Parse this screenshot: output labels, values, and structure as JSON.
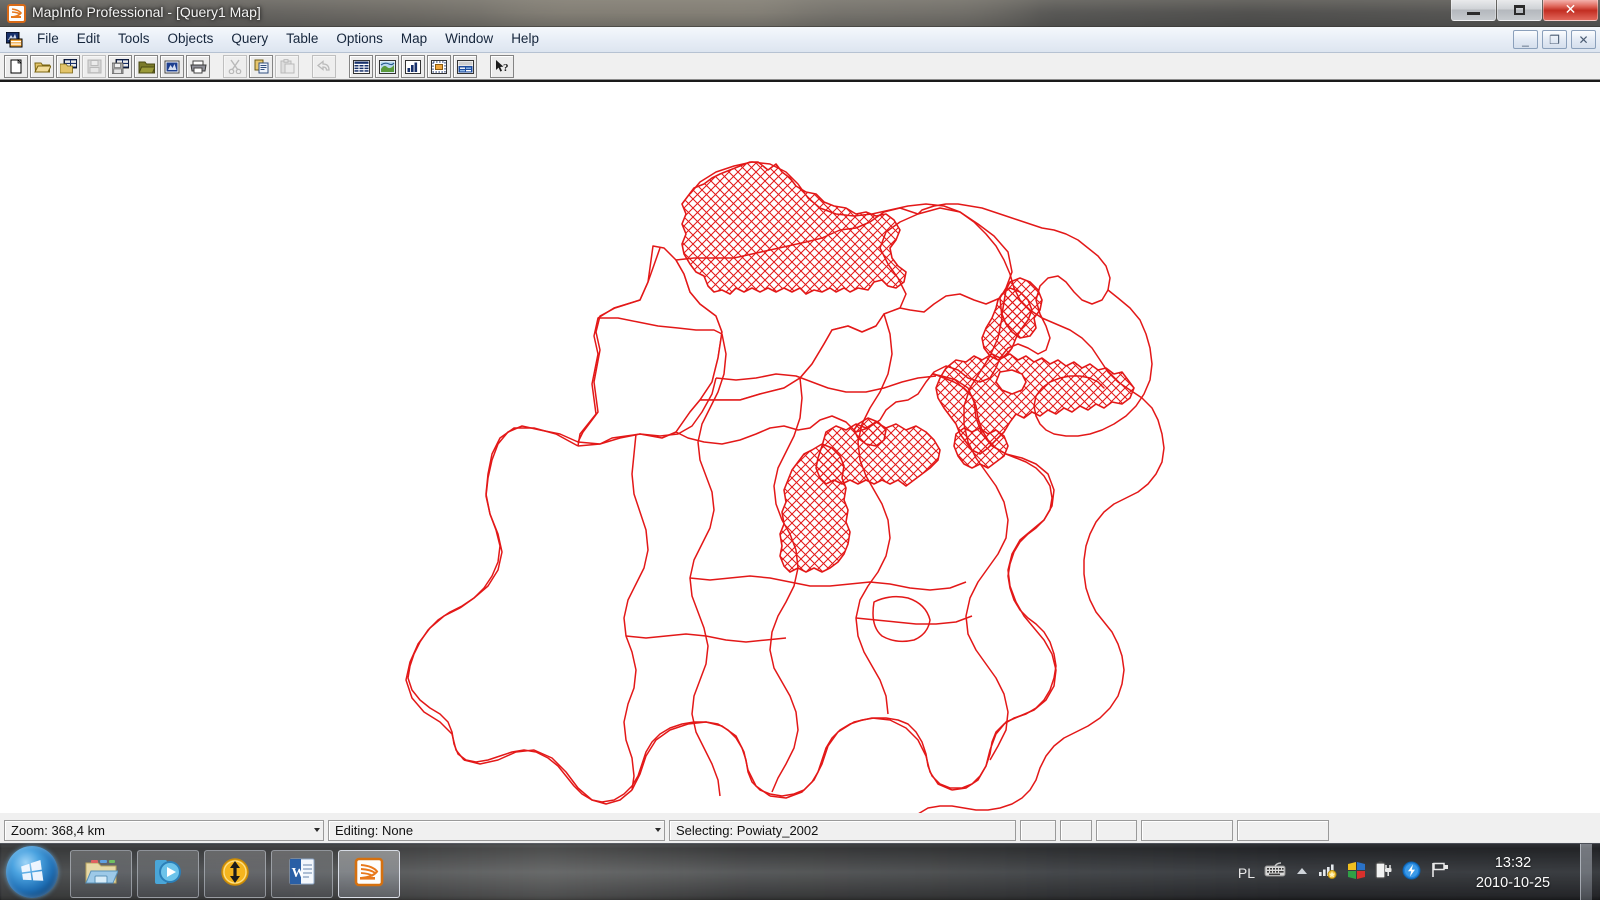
{
  "window": {
    "title": "MapInfo Professional - [Query1 Map]",
    "app_icon": "mapinfo-icon",
    "controls": {
      "minimize": "–",
      "maximize": "□",
      "close": "✕"
    }
  },
  "menubar": {
    "mdi_icon": "mapinfo-document-icon",
    "items": [
      {
        "label": "File"
      },
      {
        "label": "Edit"
      },
      {
        "label": "Tools"
      },
      {
        "label": "Objects"
      },
      {
        "label": "Query"
      },
      {
        "label": "Table"
      },
      {
        "label": "Options"
      },
      {
        "label": "Map"
      },
      {
        "label": "Window"
      },
      {
        "label": "Help"
      }
    ],
    "mdi_controls": {
      "minimize": "_",
      "restore": "❐",
      "close": "✕"
    }
  },
  "toolbar": {
    "buttons": [
      {
        "name": "new-table-icon",
        "title": "New Table",
        "enabled": true
      },
      {
        "name": "open-table-icon",
        "title": "Open Table",
        "enabled": true
      },
      {
        "name": "open-workspace-icon",
        "title": "Open Workspace",
        "enabled": true
      },
      {
        "name": "save-table-icon",
        "title": "Save Table",
        "enabled": false
      },
      {
        "name": "save-workspace-icon",
        "title": "Save Workspace",
        "enabled": true
      },
      {
        "name": "open-folder-icon",
        "title": "Open Directory",
        "enabled": true
      },
      {
        "name": "print-preview-icon",
        "title": "Print Preview",
        "enabled": true
      },
      {
        "name": "print-icon",
        "title": "Print",
        "enabled": true
      },
      {
        "name": "cut-icon",
        "title": "Cut",
        "enabled": false
      },
      {
        "name": "copy-icon",
        "title": "Copy",
        "enabled": true
      },
      {
        "name": "paste-icon",
        "title": "Paste",
        "enabled": false
      },
      {
        "name": "undo-icon",
        "title": "Undo",
        "enabled": false
      },
      {
        "name": "new-browser-icon",
        "title": "New Browser",
        "enabled": true
      },
      {
        "name": "new-mapper-icon",
        "title": "New Mapper",
        "enabled": true
      },
      {
        "name": "new-grapher-icon",
        "title": "New Grapher",
        "enabled": true
      },
      {
        "name": "new-layout-icon",
        "title": "New Layout",
        "enabled": true
      },
      {
        "name": "new-redistrict-icon",
        "title": "New Redistricter",
        "enabled": true
      },
      {
        "name": "help-pointer-icon",
        "title": "Context Help",
        "enabled": true
      }
    ]
  },
  "statusbar": {
    "zoom": "Zoom: 368,4 km",
    "editing": "Editing: None",
    "selecting": "Selecting: Powiaty_2002",
    "extra_panes": [
      "",
      "",
      "",
      "",
      ""
    ]
  },
  "map": {
    "layer_name": "Powiaty_2002",
    "border_color": "#e31818",
    "fill_color": "#ffffff",
    "selection_pattern": "cross-hatch",
    "selection_color": "#e31818",
    "background": "#ffffff",
    "selected_region_count": 4
  },
  "taskbar": {
    "start_button": "start-orb-icon",
    "apps": [
      {
        "name": "explorer-icon",
        "label": "Windows Explorer"
      },
      {
        "name": "media-player-icon",
        "label": "Windows Media Player"
      },
      {
        "name": "resize-arrows-icon",
        "label": "Utility"
      },
      {
        "name": "word-icon",
        "label": "Microsoft Word"
      },
      {
        "name": "mapinfo-icon",
        "label": "MapInfo Professional"
      }
    ],
    "tray": {
      "language": "PL",
      "icons": [
        {
          "name": "keyboard-icon"
        },
        {
          "name": "chevron-up-icon"
        },
        {
          "name": "network-signal-icon"
        },
        {
          "name": "colored-squares-icon"
        },
        {
          "name": "battery-plug-icon"
        },
        {
          "name": "blue-lightning-icon"
        },
        {
          "name": "flag-icon"
        }
      ],
      "time": "13:32",
      "date": "2010-10-25"
    }
  }
}
